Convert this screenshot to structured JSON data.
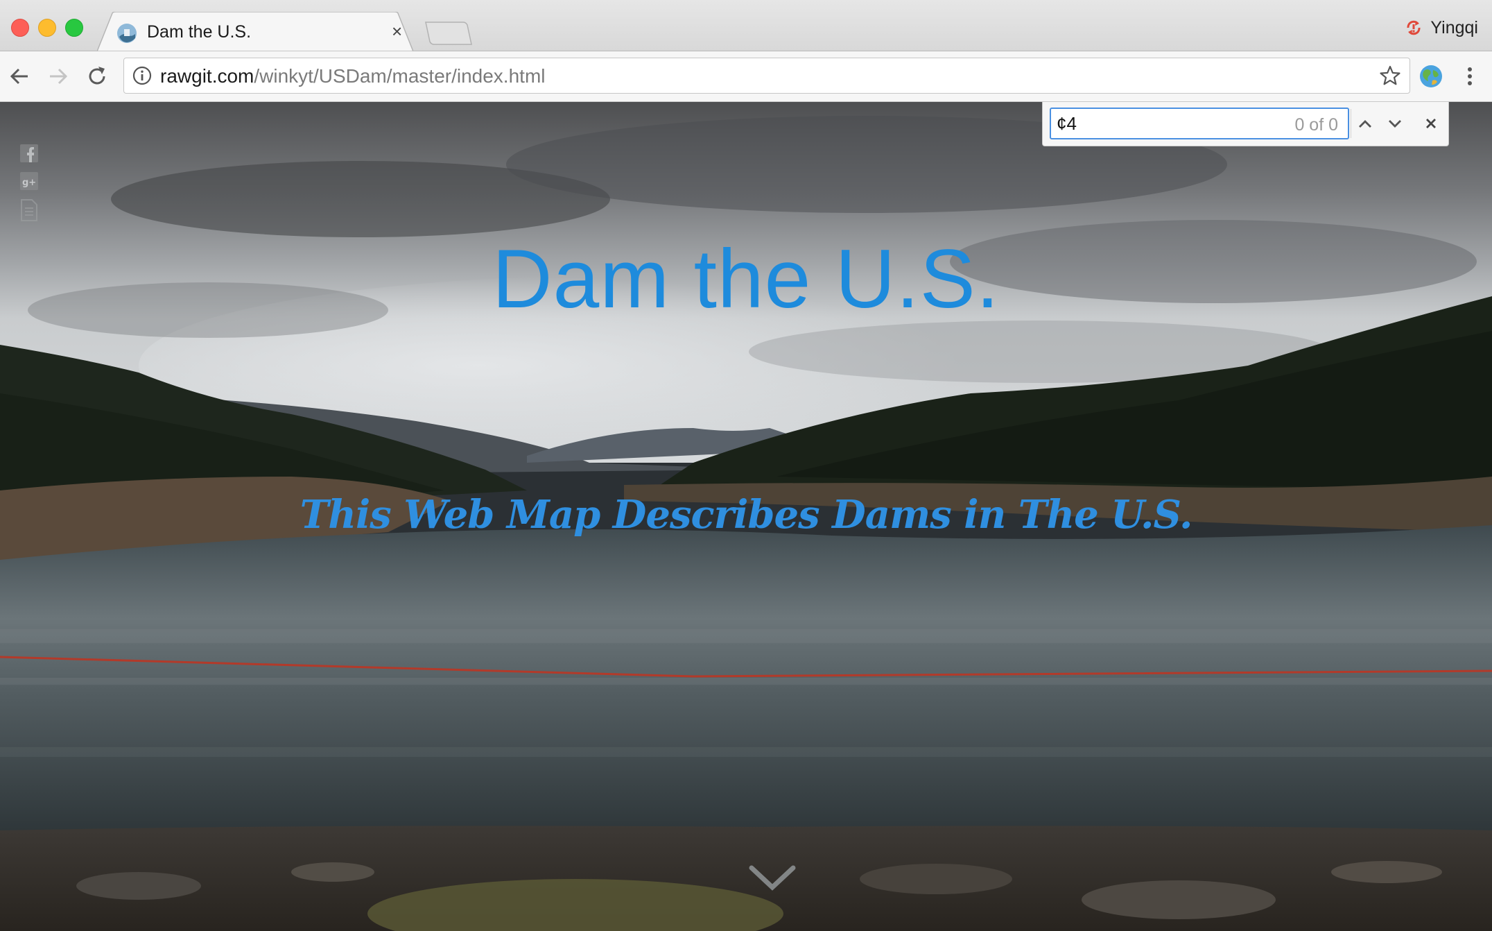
{
  "window": {
    "tab_title": "Dam the U.S.",
    "profile_name": "Yingqi"
  },
  "address_bar": {
    "host": "rawgit.com",
    "path": "/winkyt/USDam/master/index.html"
  },
  "find_bar": {
    "query": "¢4",
    "count": "0 of 0"
  },
  "page": {
    "title": "Dam the U.S.",
    "subtitle": "This Web Map Describes Dams in The U.S.",
    "accent_color": "#1e8bdc"
  },
  "icons": [
    "facebook-icon",
    "google-plus-icon",
    "document-icon",
    "scroll-down-chevron-icon"
  ]
}
